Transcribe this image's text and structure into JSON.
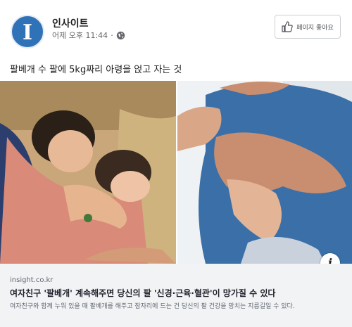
{
  "post": {
    "page_name": "인사이트",
    "timestamp": "어제 오후 11:44",
    "avatar_letter": "I",
    "like_page_label": "페이지 좋아요",
    "caption": "팔베개 수 팔에 5kg짜리 아령을 얹고 자는 것"
  },
  "link_preview": {
    "domain": "insight.co.kr",
    "title": "여자친구 '팔베개' 계속해주면 당신의 팔 '신경·근육·혈관'이 망가질 수 있다",
    "description": "여자친구와 함께 누워 있을 때 팔베개를 해주고 잠자리에 드는 건 당신의 팔 건강을 망치는 지름길일 수 있다.",
    "info_glyph": "i"
  },
  "colors": {
    "brand_blue": "#2f72b8",
    "link_box_bg": "#f2f3f5"
  }
}
